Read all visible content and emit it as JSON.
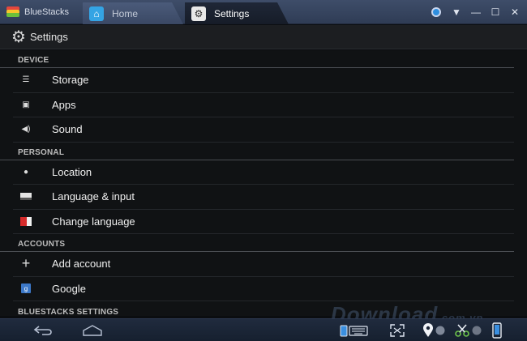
{
  "titlebar": {
    "app_name": "BlueStacks",
    "tabs": [
      {
        "label": "Home",
        "icon": "home-icon"
      },
      {
        "label": "Settings",
        "icon": "gear-icon"
      }
    ],
    "controls": [
      "user-icon",
      "menu-down-icon",
      "minimize-icon",
      "maximize-icon",
      "close-icon"
    ]
  },
  "actionbar": {
    "title": "Settings",
    "icon": "gear-icon"
  },
  "sections": [
    {
      "header": "DEVICE",
      "items": [
        {
          "label": "Storage",
          "icon": "storage-icon"
        },
        {
          "label": "Apps",
          "icon": "apps-icon"
        },
        {
          "label": "Sound",
          "icon": "speaker-icon"
        }
      ]
    },
    {
      "header": "PERSONAL",
      "items": [
        {
          "label": "Location",
          "icon": "location-pin-icon"
        },
        {
          "label": "Language & input",
          "icon": "keyboard-icon"
        },
        {
          "label": "Change language",
          "icon": "flag-icon"
        }
      ]
    },
    {
      "header": "ACCOUNTS",
      "items": [
        {
          "label": "Add account",
          "icon": "plus-icon"
        },
        {
          "label": "Google",
          "icon": "google-icon"
        }
      ]
    },
    {
      "header": "BLUESTACKS SETTINGS",
      "items": []
    }
  ],
  "watermark": {
    "text": "Download",
    "suffix": ".com.vn"
  },
  "colors": {
    "accent": "#34a4e4",
    "titlebar": "#3a4864",
    "background": "#101214"
  }
}
